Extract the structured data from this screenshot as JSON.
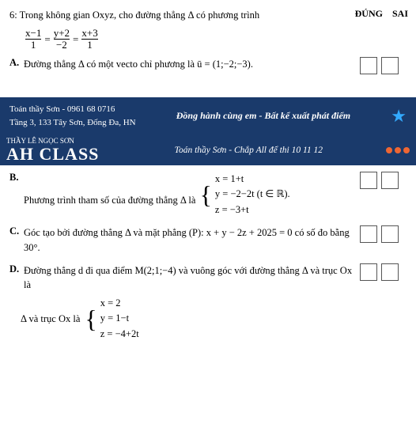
{
  "header": {
    "question_number": "6:",
    "question_text": "Trong không gian Oxyz, cho đường thẳng Δ có phương trình",
    "equation": {
      "parts": [
        {
          "numerator": "x−1",
          "denominator": "1"
        },
        {
          "numerator": "y+2",
          "denominator": "−2"
        },
        {
          "numerator": "x+3",
          "denominator": "1"
        }
      ]
    },
    "right_labels": [
      "ĐÚNG",
      "SAI"
    ]
  },
  "options": {
    "A": {
      "label": "A.",
      "text": "Đường thẳng Δ có một vecto chỉ phương là ",
      "vector": "ū = (1;−2;−3)."
    },
    "B": {
      "label": "B.",
      "text": "Phương trình tham số của đường thẳng Δ là",
      "piecewise": [
        "x = 1+t",
        "y = −2−2t (t ∈ ℝ).",
        "z = −3+t"
      ]
    },
    "C": {
      "label": "C.",
      "text": "Góc tạo bởi đường thẳng Δ và mặt phẳng (P): x + y − 2z + 2025 = 0 có số đo bằng 30°."
    },
    "D": {
      "label": "D.",
      "text": "Đường thẳng d đi qua điểm M(2;1;−4) và vuông góc với đường thẳng Δ và trục Ox là",
      "piecewise": [
        "x = 2",
        "y = 1−t",
        "z = −4+2t"
      ]
    }
  },
  "banner": {
    "phone": "Toán thầy Sơn - 0961 68 0716",
    "address": "Tầng 3, 133 Tây Sơn, Đống Đa, HN",
    "slogan": "Đồng hành cùng em - Bất kể xuất phát điểm"
  },
  "logo_bar": {
    "teacher_name": "THẦY LÊ NGỌC SƠN",
    "class_name": "AH CLASS",
    "subtitle": "Toán thầy Sơn - Chắp All để thi 10 11 12",
    "dots": [
      "#e63",
      "#e63",
      "#e63"
    ]
  }
}
